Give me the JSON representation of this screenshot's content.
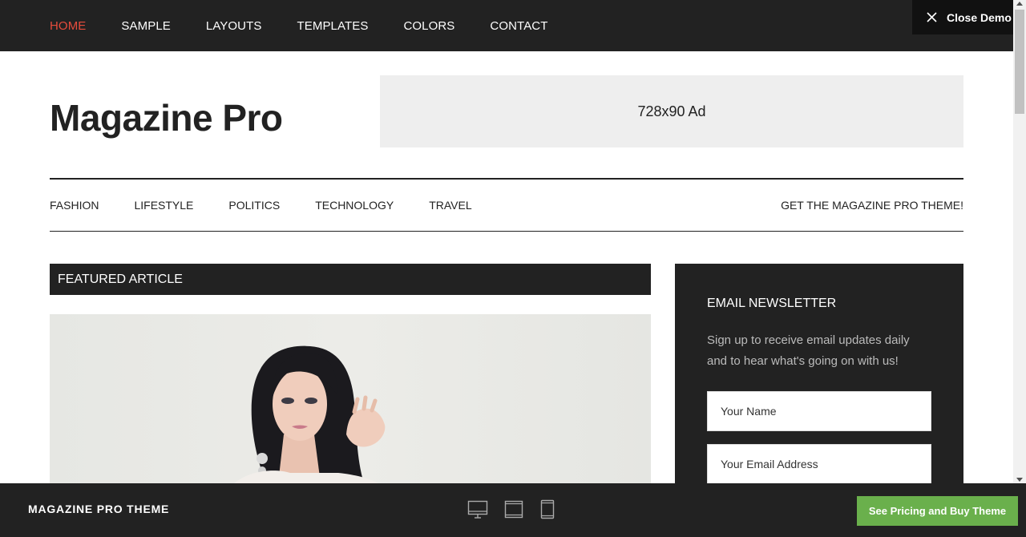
{
  "topnav": {
    "items": [
      {
        "label": "HOME",
        "active": true
      },
      {
        "label": "SAMPLE"
      },
      {
        "label": "LAYOUTS"
      },
      {
        "label": "TEMPLATES"
      },
      {
        "label": "COLORS"
      },
      {
        "label": "CONTACT"
      }
    ],
    "close_demo_label": "Close Demo"
  },
  "header": {
    "site_title": "Magazine Pro",
    "ad_label": "728x90 Ad"
  },
  "subnav": {
    "items": [
      "FASHION",
      "LIFESTYLE",
      "POLITICS",
      "TECHNOLOGY",
      "TRAVEL"
    ],
    "cta": "GET THE MAGAZINE PRO THEME!"
  },
  "featured": {
    "heading": "FEATURED ARTICLE"
  },
  "newsletter": {
    "heading": "EMAIL NEWSLETTER",
    "description": "Sign up to receive email updates daily and to hear what's going on with us!",
    "name_placeholder": "Your Name",
    "email_placeholder": "Your Email Address"
  },
  "bottombar": {
    "title": "MAGAZINE PRO THEME",
    "buy_label": "See Pricing and Buy Theme"
  },
  "colors": {
    "dark": "#222222",
    "accent_red": "#e64c3c",
    "buy_green": "#6ab04c"
  }
}
